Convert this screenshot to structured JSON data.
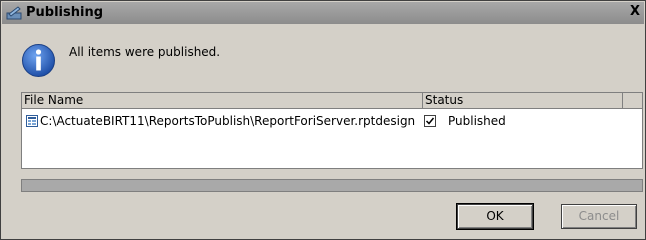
{
  "window": {
    "title": "Publishing",
    "close_label": "X"
  },
  "message": {
    "text": "All items were published."
  },
  "table": {
    "columns": [
      "File Name",
      "Status",
      ""
    ],
    "rows": [
      {
        "file_name": "C:\\ActuateBIRT11\\ReportsToPublish\\ReportForiServer.rptdesign",
        "status": "Published",
        "checked": true
      }
    ]
  },
  "progress": {
    "fraction": 1.0
  },
  "buttons": {
    "ok_label": "OK",
    "cancel_label": "Cancel"
  },
  "colors": {
    "dialog_bg": "#d4d0c8",
    "titlebar": "#999999",
    "info_blue": "#1f5fbf",
    "disabled_text": "#8c8c8c"
  },
  "icons": {
    "title": "publish-icon",
    "message": "info-icon",
    "file": "report-file-icon",
    "status": "checkbox-checked-icon"
  }
}
